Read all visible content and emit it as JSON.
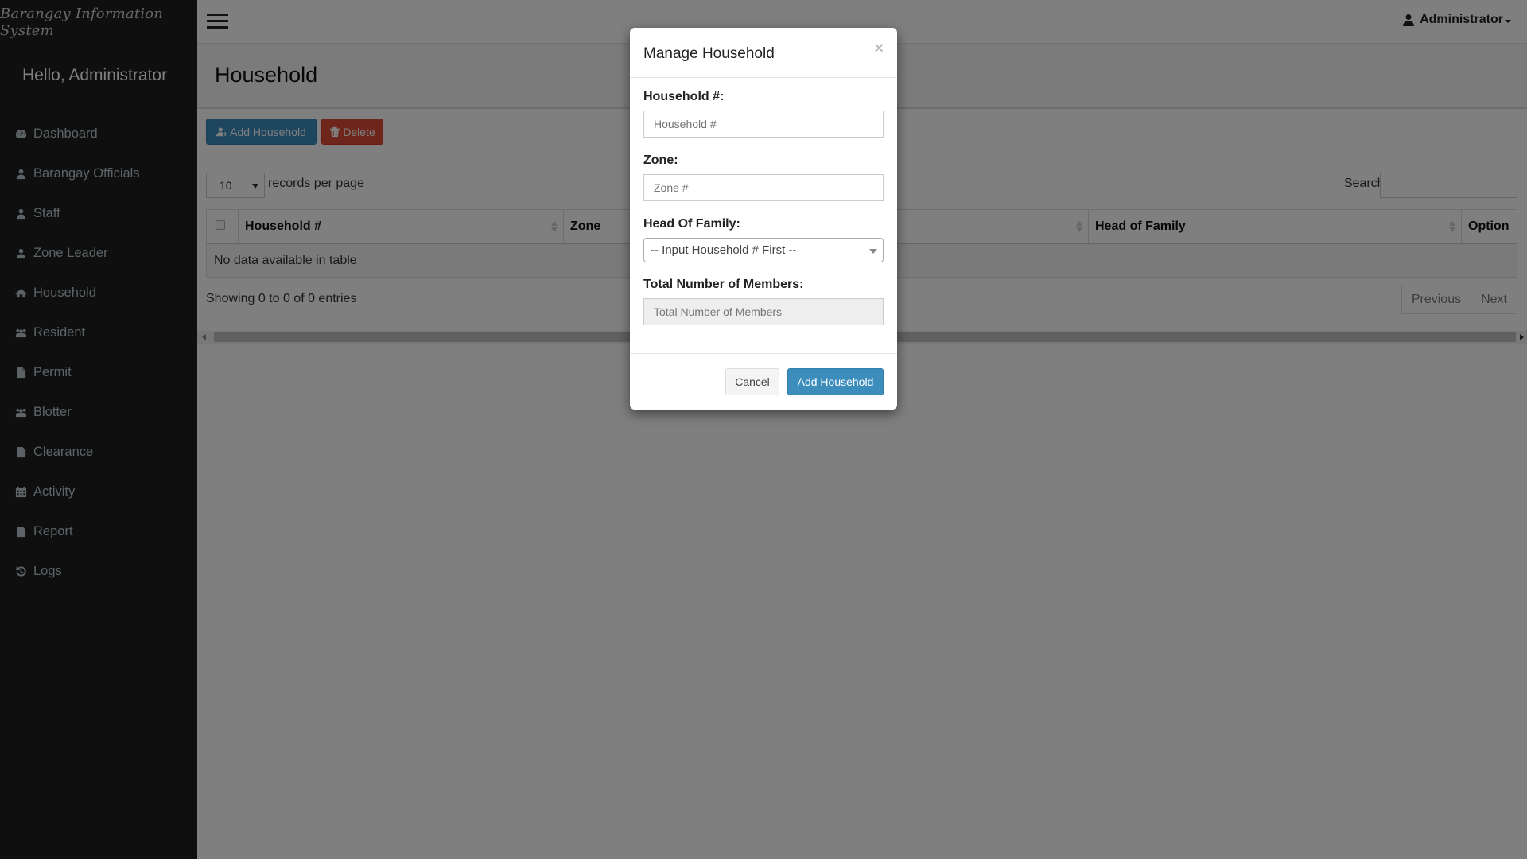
{
  "sidebar": {
    "brand": "Barangay Information System",
    "greeting": "Hello, Administrator",
    "items": [
      {
        "label": "Dashboard",
        "icon": "dashboard-icon"
      },
      {
        "label": "Barangay Officials",
        "icon": "user-icon"
      },
      {
        "label": "Staff",
        "icon": "user-icon"
      },
      {
        "label": "Zone Leader",
        "icon": "user-icon"
      },
      {
        "label": "Household",
        "icon": "home-icon"
      },
      {
        "label": "Resident",
        "icon": "users-icon"
      },
      {
        "label": "Permit",
        "icon": "file-icon"
      },
      {
        "label": "Blotter",
        "icon": "users-icon"
      },
      {
        "label": "Clearance",
        "icon": "file-icon"
      },
      {
        "label": "Activity",
        "icon": "calendar-icon"
      },
      {
        "label": "Report",
        "icon": "file-icon"
      },
      {
        "label": "Logs",
        "icon": "history-icon"
      }
    ]
  },
  "topbar": {
    "menu_icon": "hamburger-icon",
    "user_label": "Administrator"
  },
  "page": {
    "title": "Household",
    "add_button": "Add Household",
    "delete_button": "Delete",
    "length_value": "10",
    "length_label": "records per page",
    "search_label": "Search:",
    "search_value": "",
    "table": {
      "columns": [
        "Household #",
        "Zone",
        "Head of Family",
        "Option"
      ],
      "empty_message": "No data available in table"
    },
    "info": "Showing 0 to 0 of 0 entries",
    "pagination": {
      "previous": "Previous",
      "next": "Next"
    }
  },
  "modal": {
    "title": "Manage Household",
    "close": "×",
    "fields": {
      "household_label": "Household #:",
      "household_placeholder": "Household #",
      "household_value": "",
      "zone_label": "Zone:",
      "zone_placeholder": "Zone #",
      "zone_value": "",
      "head_label": "Head Of Family:",
      "head_selected": "-- Input Household # First --",
      "members_label": "Total Number of Members:",
      "members_placeholder": "Total Number of Members"
    },
    "cancel_button": "Cancel",
    "submit_button": "Add Household"
  },
  "colors": {
    "primary": "#3c8dbc",
    "danger": "#dd4b39",
    "sidebar_bg": "#1f1f1f"
  }
}
